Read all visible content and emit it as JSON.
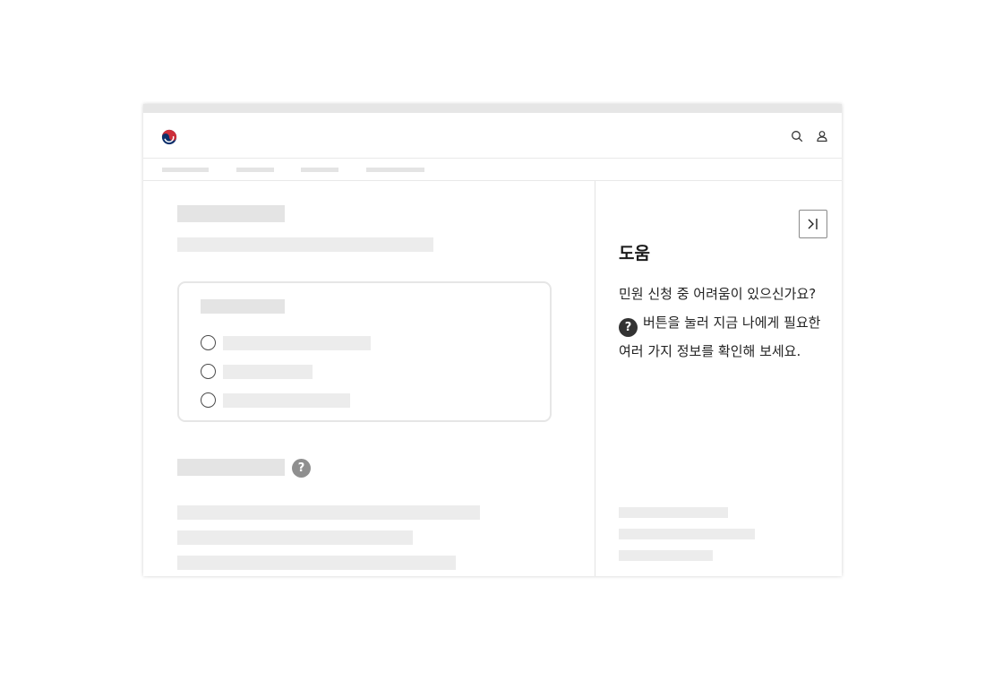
{
  "help_panel": {
    "title": "도움",
    "line1": "민원 신청 중 어려움이 있으신가요?",
    "line2_icon": "?",
    "line2": "버튼을 눌러 지금 나에게 필요한",
    "line3": "여러 가지 정보를 확인해 보세요.",
    "collapse_icon": "panel-collapse-right-icon"
  },
  "header": {
    "logo_icon": "government-taegeuk-logo",
    "icons": [
      "search-icon",
      "user-icon"
    ]
  },
  "main": {
    "help_badge": "?",
    "radio_options_count_note": "",
    "colors": {
      "skeleton": "#e4e4e4",
      "radio_border": "#4a4a4a",
      "help_badge": "#8f8f8f"
    }
  }
}
